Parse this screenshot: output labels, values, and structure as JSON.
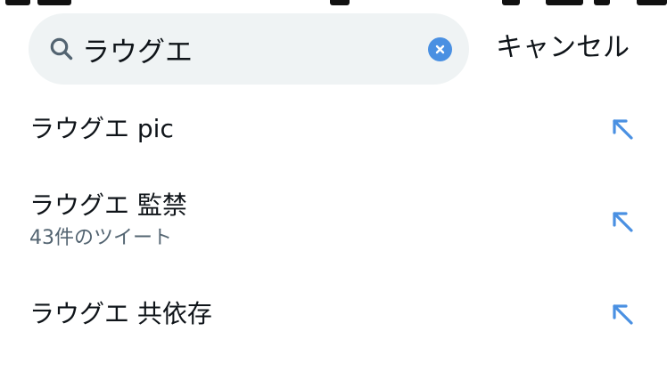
{
  "search": {
    "query": "ラウグエ",
    "clear_label": "×",
    "cancel_label": "キャンセル"
  },
  "suggestions": [
    {
      "title": "ラウグエ pic",
      "meta": ""
    },
    {
      "title": "ラウグエ 監禁",
      "meta": "43件のツイート"
    },
    {
      "title": "ラウグエ 共依存",
      "meta": ""
    }
  ],
  "colors": {
    "search_background": "#eff3f4",
    "accent": "#4a90e2",
    "secondary_text": "#536471",
    "primary_text": "#0f1419"
  },
  "icons": {
    "search": "search-icon",
    "clear": "clear-icon",
    "fill_query": "arrow-up-left-icon"
  }
}
